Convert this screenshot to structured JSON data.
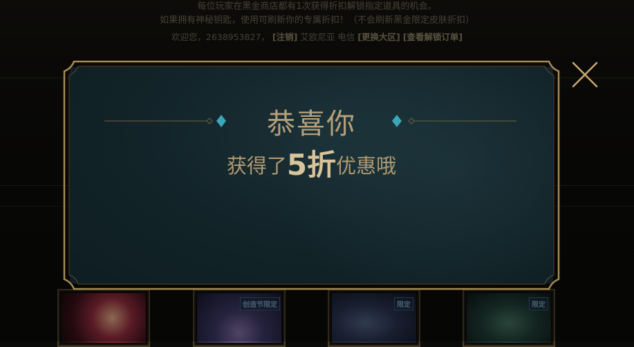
{
  "notice": {
    "line1": "每位玩家在黑金商店都有1次获得折扣解锁指定道具的机会。",
    "line2": "如果拥有神秘钥匙，使用可刷新你的专属折扣！（不会刷新黑金限定皮肤折扣）",
    "welcome_prefix": "欢迎您，",
    "account_id": "2638953827",
    "logout_label": "[注销]",
    "server": "艾欧尼亚 电信",
    "change_server_label": "[更换大区]",
    "view_orders_label": "[查看解锁订单]"
  },
  "modal": {
    "title": "恭喜你",
    "subtitle_prefix": "获得了",
    "discount": "5折",
    "subtitle_suffix": "优惠哦"
  },
  "skins": [
    {
      "badge": ""
    },
    {
      "badge": "创造节限定"
    },
    {
      "badge": "限定"
    },
    {
      "badge": "限定"
    }
  ],
  "colors": {
    "gold": "#b6a078",
    "gold_light": "#d8c49a",
    "modal_bg": "#13252a",
    "frame_gold": "#a58a55",
    "gem_teal": "#3aa6b9"
  },
  "icons": {
    "close": "close-icon",
    "diamond": "diamond-icon"
  }
}
